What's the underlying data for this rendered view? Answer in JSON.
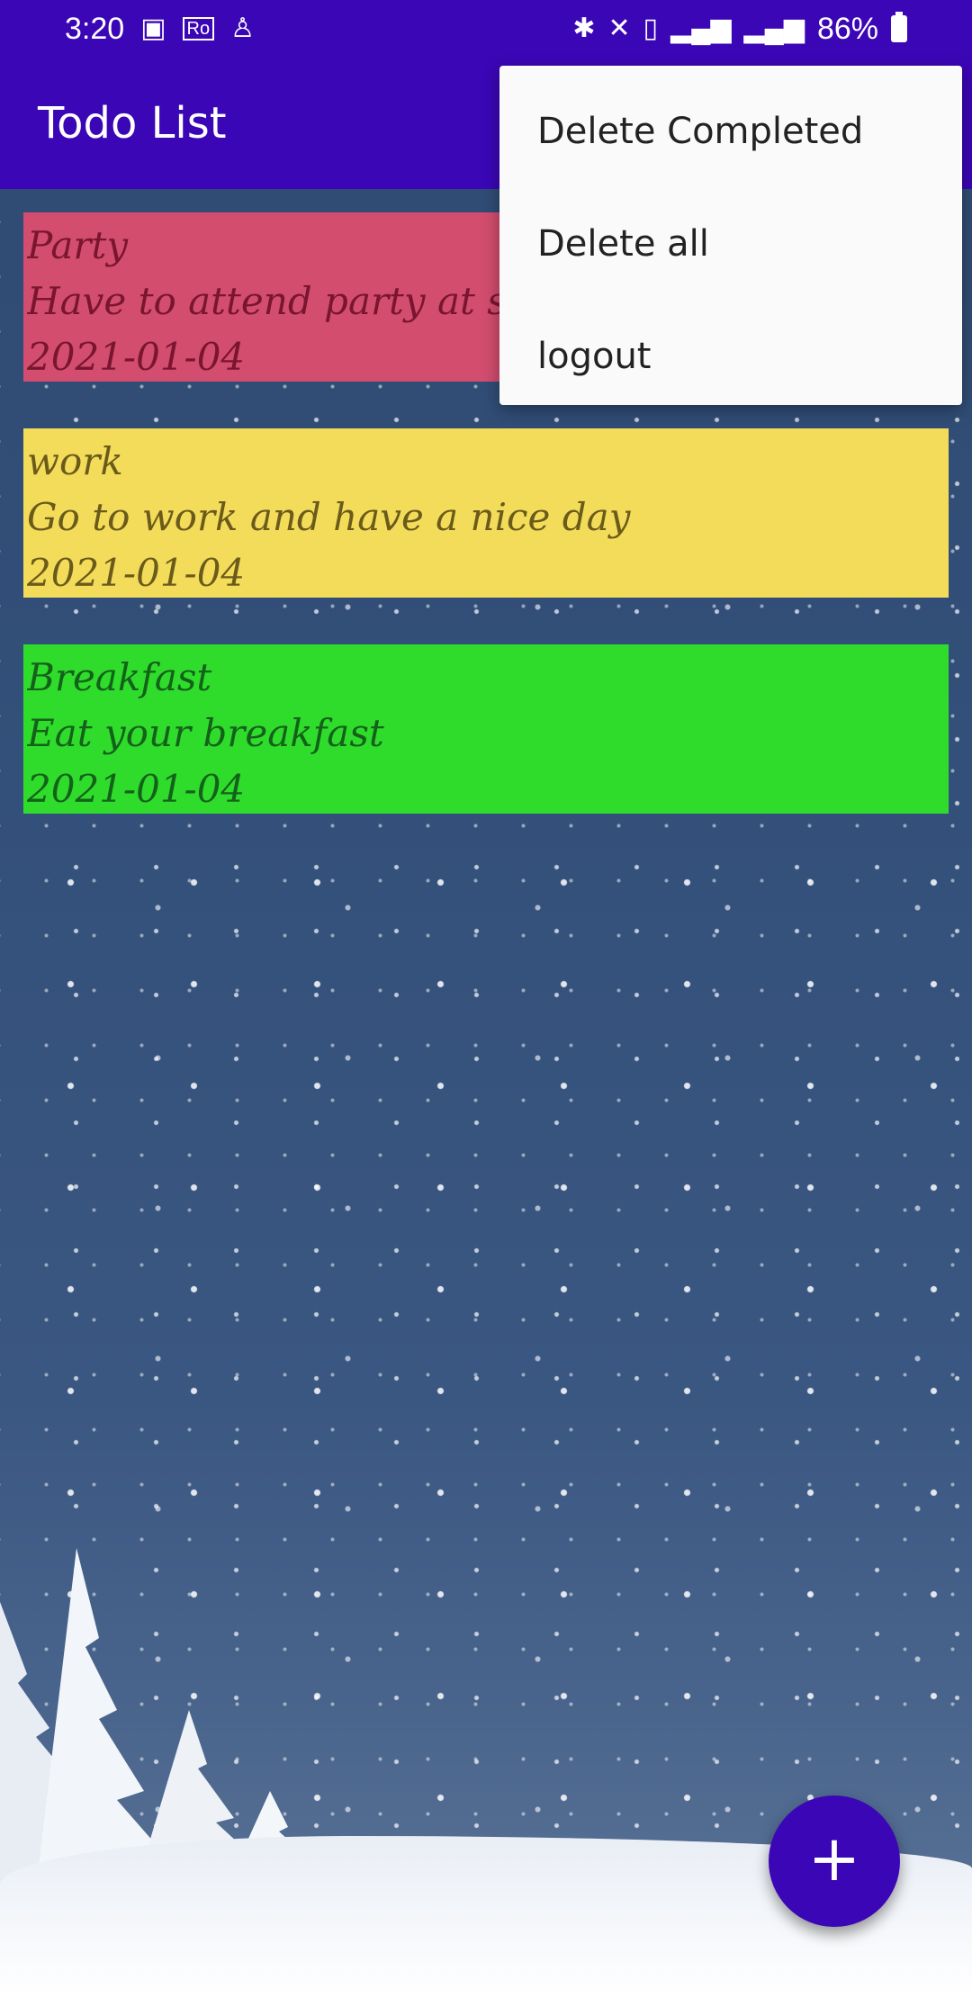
{
  "status_bar": {
    "time": "3:20",
    "left_icons": [
      "image-icon",
      "ro-icon",
      "notification-figure-icon"
    ],
    "right_icons": [
      "bluetooth-icon",
      "mute-icon",
      "battery-saver-icon",
      "signal-icon",
      "signal-icon"
    ],
    "battery_percent": "86%"
  },
  "app_bar": {
    "title": "Todo List",
    "background_color": "#3b06b5"
  },
  "todos": [
    {
      "title": "Party",
      "description": "Have to attend party at sc",
      "date": "2021-01-04",
      "bg_color": "#d24d6e",
      "text_color": "#7a1530"
    },
    {
      "title": "work",
      "description": "Go to work and have a nice day",
      "date": "2021-01-04",
      "bg_color": "#f4dc5b",
      "text_color": "#6b5b1a"
    },
    {
      "title": "Breakfast",
      "description": "Eat your breakfast",
      "date": "2021-01-04",
      "bg_color": "#2fdc2c",
      "text_color": "#14621a"
    }
  ],
  "overflow_menu": {
    "items": [
      "Delete Completed",
      "Delete all",
      "logout"
    ]
  },
  "fab": {
    "label": "+",
    "icon": "add-icon"
  }
}
